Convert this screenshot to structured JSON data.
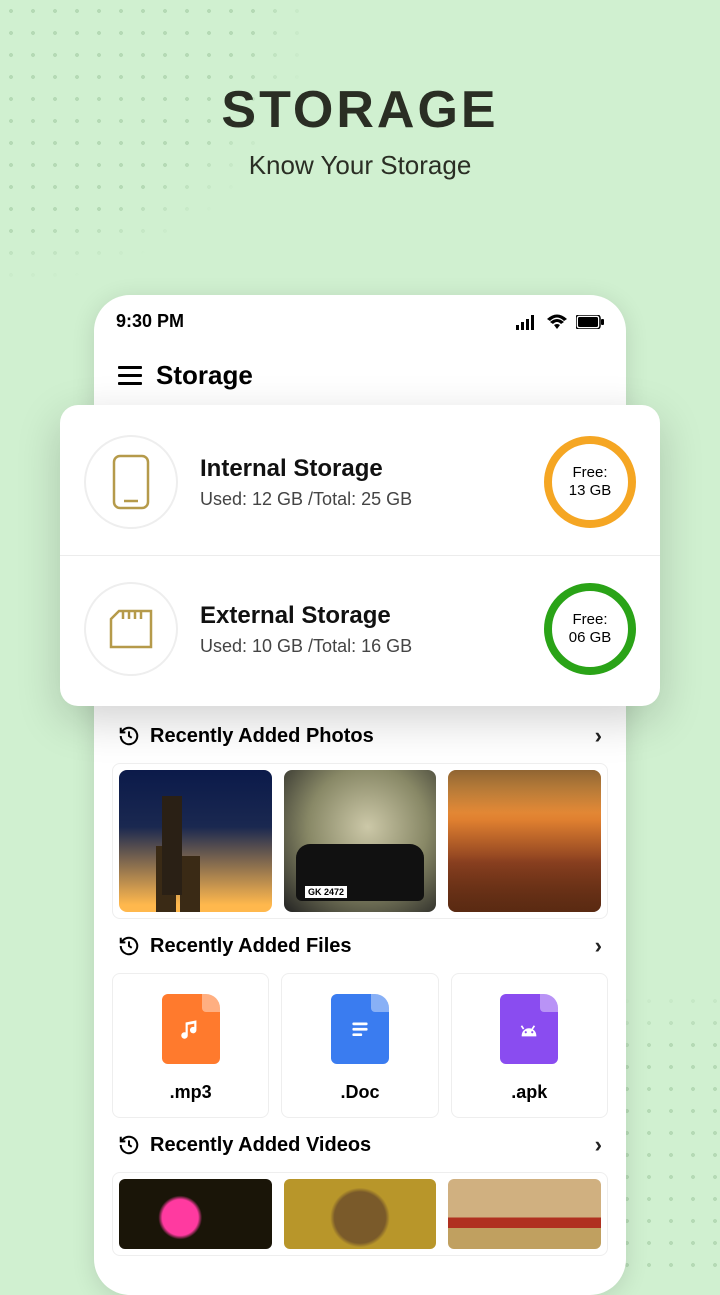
{
  "hero": {
    "title": "STORAGE",
    "subtitle": "Know Your Storage"
  },
  "statusbar": {
    "time": "9:30 PM"
  },
  "header": {
    "title": "Storage"
  },
  "storage": {
    "internal": {
      "name": "Internal Storage",
      "usage": "Used: 12 GB /Total: 25 GB",
      "free_label": "Free:",
      "free_value": "13 GB"
    },
    "external": {
      "name": "External Storage",
      "usage": "Used: 10 GB /Total:  16 GB",
      "free_label": "Free:",
      "free_value": "06 GB"
    }
  },
  "sections": {
    "photos": {
      "label": "Recently Added Photos"
    },
    "files": {
      "label": "Recently Added Files",
      "items": [
        {
          "ext": ".mp3"
        },
        {
          "ext": ".Doc"
        },
        {
          "ext": ".apk"
        }
      ]
    },
    "videos": {
      "label": "Recently Added Videos"
    }
  }
}
